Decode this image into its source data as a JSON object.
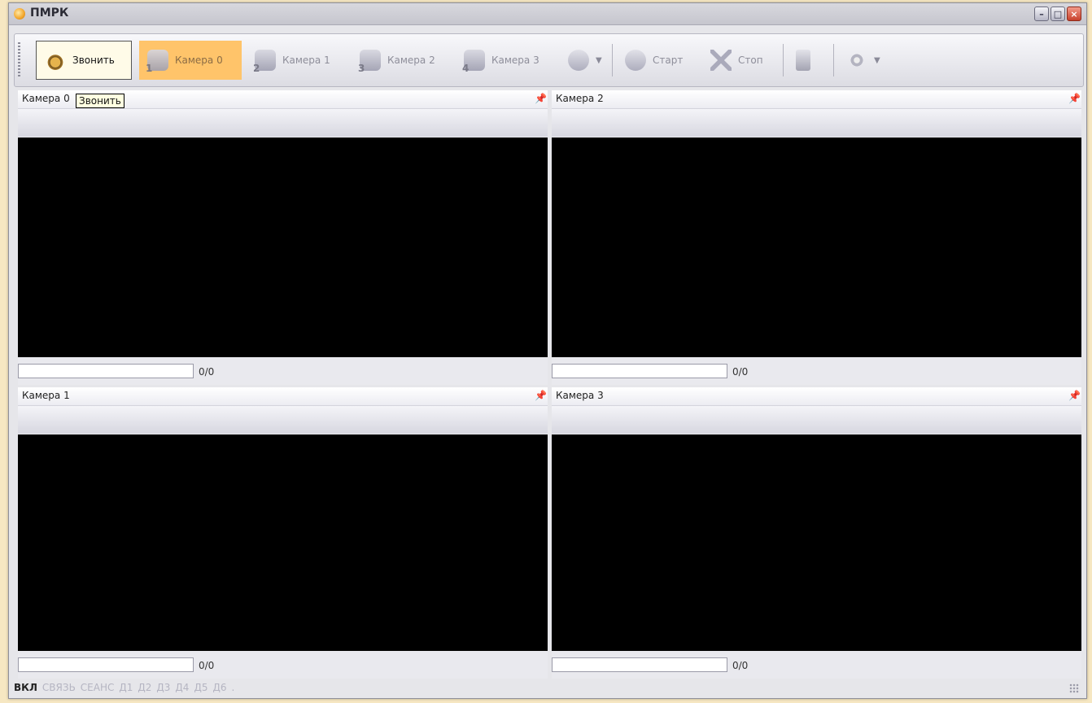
{
  "window": {
    "title": "ПМРК"
  },
  "toolbar": {
    "call_label": "Звонить",
    "camera_buttons": [
      "Камера 0",
      "Камера 1",
      "Камера 2",
      "Камера 3"
    ],
    "camera_numbers": [
      "1",
      "2",
      "3",
      "4"
    ],
    "start_label": "Старт",
    "stop_label": "Стоп"
  },
  "tooltip": {
    "text": "Звонить"
  },
  "panels": [
    {
      "title": "Камера 0",
      "counter": "0/0",
      "progress": 0
    },
    {
      "title": "Камера 2",
      "counter": "0/0",
      "progress": 0
    },
    {
      "title": "Камера 1",
      "counter": "0/0",
      "progress": 0
    },
    {
      "title": "Камера 3",
      "counter": "0/0",
      "progress": 0
    }
  ],
  "statusbar": {
    "items": [
      "ВКЛ",
      "СВЯЗЬ",
      "СЕАНС",
      "Д1",
      "Д2",
      "Д3",
      "Д4",
      "Д5",
      "Д6",
      "."
    ]
  },
  "colors": {
    "active_button": "#ffc46a",
    "video_bg": "#000000"
  }
}
